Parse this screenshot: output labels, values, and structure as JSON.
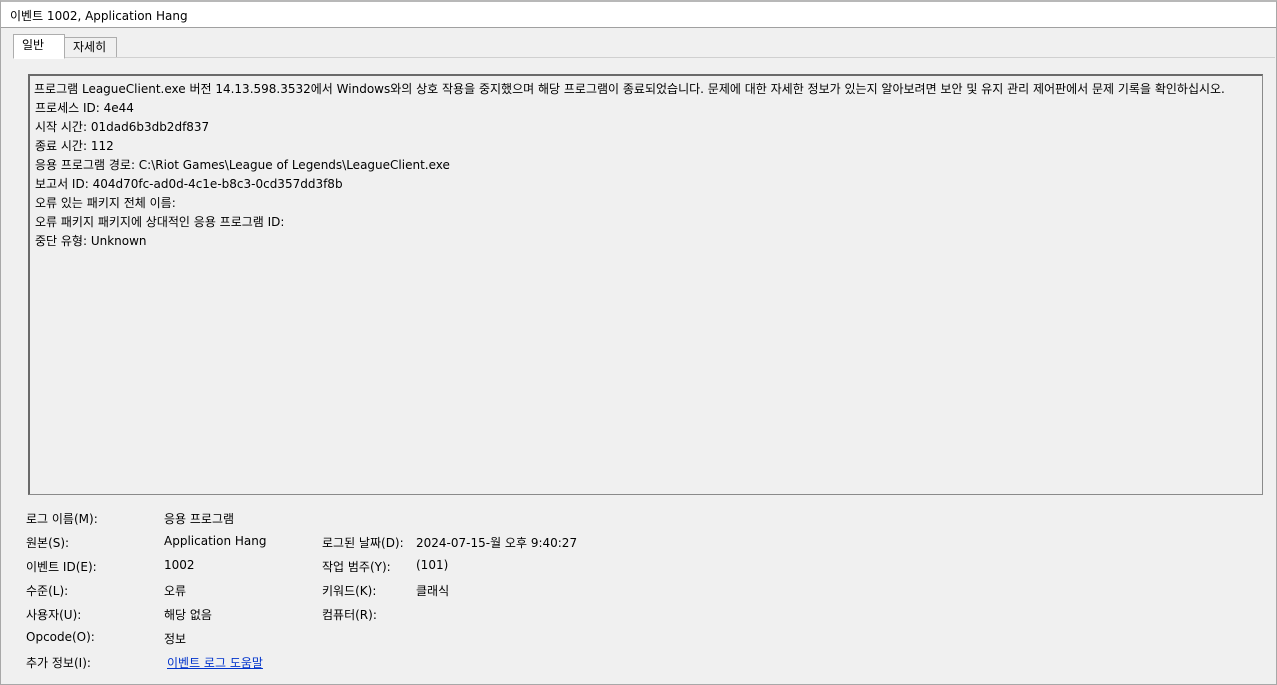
{
  "window": {
    "title": "이벤트 1002, Application Hang"
  },
  "tabs": [
    {
      "label": "일반",
      "active": true
    },
    {
      "label": "자세히",
      "active": false
    }
  ],
  "description": {
    "paragraph": "프로그램 LeagueClient.exe 버전 14.13.598.3532에서 Windows와의 상호 작용을 중지했으며 해당 프로그램이 종료되었습니다. 문제에 대한 자세한 정보가 있는지 알아보려면 보안 및 유지 관리 제어판에서 문제 기록을 확인하십시오.",
    "lines": [
      "프로세스 ID: 4e44",
      "시작 시간: 01dad6b3db2df837",
      "종료 시간: 112",
      "응용 프로그램 경로: C:\\Riot Games\\League of Legends\\LeagueClient.exe",
      "보고서 ID: 404d70fc-ad0d-4c1e-b8c3-0cd357dd3f8b",
      "오류 있는 패키지 전체 이름:",
      "오류 패키지 패키지에 상대적인 응용 프로그램 ID:",
      "중단 유형: Unknown"
    ]
  },
  "properties": {
    "log_name": {
      "label": "로그 이름(M):",
      "value": "응용 프로그램"
    },
    "source": {
      "label": "원본(S):",
      "value": "Application Hang"
    },
    "logged": {
      "label": "로그된 날짜(D):",
      "value": "2024-07-15-월 오후 9:40:27"
    },
    "event_id": {
      "label": "이벤트 ID(E):",
      "value": "1002"
    },
    "task_category": {
      "label": "작업 범주(Y):",
      "value": "(101)"
    },
    "level": {
      "label": "수준(L):",
      "value": "오류"
    },
    "keywords": {
      "label": "키워드(K):",
      "value": "클래식"
    },
    "user": {
      "label": "사용자(U):",
      "value": "해당 없음"
    },
    "computer": {
      "label": "컴퓨터(R):",
      "value": ""
    },
    "opcode": {
      "label": "Opcode(O):",
      "value": "정보"
    },
    "more_info": {
      "label": "추가 정보(I):",
      "link_text": "이벤트 로그 도움말"
    }
  },
  "colors": {
    "background": "#f0f0f0",
    "link": "#0033cc",
    "title_bar": "#ffffff"
  }
}
